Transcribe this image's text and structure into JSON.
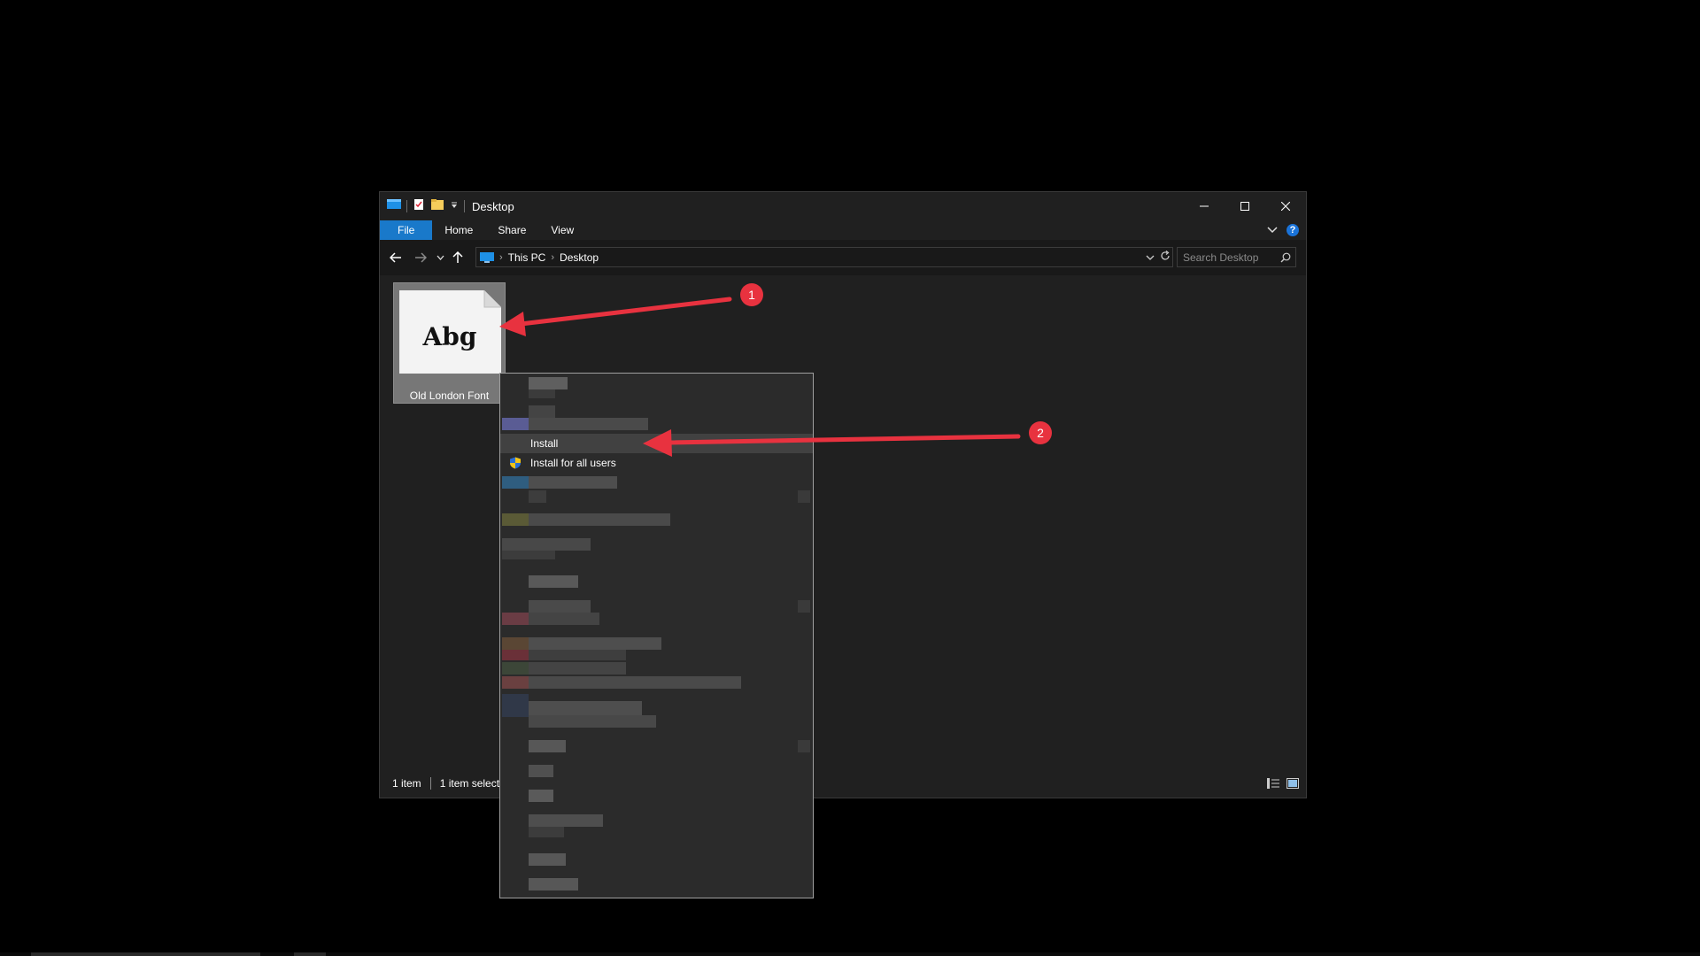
{
  "window": {
    "title": "Desktop",
    "qa_icons": [
      "explorer-icon",
      "properties-icon",
      "new-folder-icon",
      "customize-qa-icon"
    ],
    "caption": {
      "minimize": "minimize-icon",
      "maximize": "maximize-icon",
      "close": "close-icon"
    }
  },
  "ribbon": {
    "tabs": [
      "File",
      "Home",
      "Share",
      "View"
    ],
    "help_label": "?"
  },
  "nav": {
    "breadcrumb": [
      "This PC",
      "Desktop"
    ],
    "search_placeholder": "Search Desktop"
  },
  "content": {
    "file": {
      "name": "Old London Font",
      "preview_text": "Abg"
    }
  },
  "status": {
    "items_count": "1 item",
    "selected": "1 item select"
  },
  "context_menu": {
    "install_label": "Install",
    "install_all_label": "Install for all users"
  },
  "annotations": {
    "badge1": "1",
    "badge2": "2",
    "color": "#e8323f"
  },
  "colors": {
    "accent": "#1979ca",
    "window_bg": "#202020",
    "menu_bg": "#2b2b2b"
  }
}
